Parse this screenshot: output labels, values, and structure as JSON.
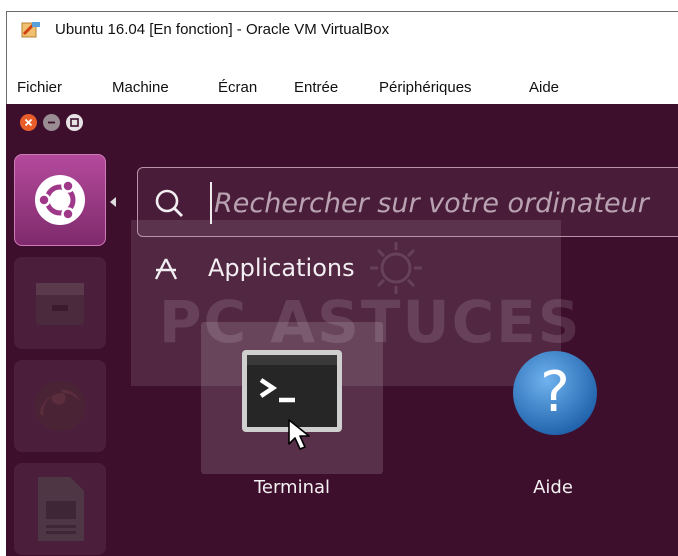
{
  "window": {
    "title": "Ubuntu 16.04 [En fonction] - Oracle VM VirtualBox",
    "icon": "virtualbox-icon"
  },
  "menubar": {
    "items": [
      "Fichier",
      "Machine",
      "Écran",
      "Entrée",
      "Périphériques",
      "Aide"
    ]
  },
  "guest": {
    "window_controls": [
      "close-icon",
      "minimize-icon",
      "maximize-icon"
    ],
    "search": {
      "placeholder": "Rechercher sur votre ordinateur",
      "value": ""
    },
    "section_header": "Applications",
    "watermark": "PC ASTUCES",
    "apps": [
      {
        "label": "Terminal",
        "icon": "terminal-icon"
      },
      {
        "label": "Aide",
        "icon": "help-icon"
      }
    ],
    "launcher": [
      "ubuntu-dash-icon",
      "files-icon",
      "firefox-icon",
      "libreoffice-impress-icon"
    ]
  },
  "colors": {
    "accent": "#772953",
    "background": "#3e0f2d",
    "close": "#e85d29",
    "help_blue": "#2f7bc4"
  }
}
